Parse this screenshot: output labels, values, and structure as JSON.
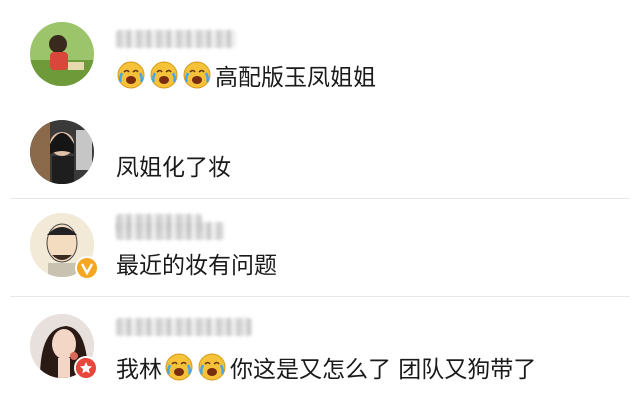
{
  "comments": [
    {
      "text_after": "高配版玉凤姐姐",
      "emoji": "laugh-cry-icon",
      "emoji_count_before": 3
    },
    {
      "text": "凤姐化了妆"
    },
    {
      "text": "最近的妆有问题",
      "badge_color": "#f5a623"
    },
    {
      "segment1": "我林",
      "segment2": "你这是又怎么了 团队又狗带了",
      "badge_color": "#e8473c"
    }
  ],
  "colors": {
    "divider": "#e8e8e8",
    "text": "#1a1a1a"
  }
}
